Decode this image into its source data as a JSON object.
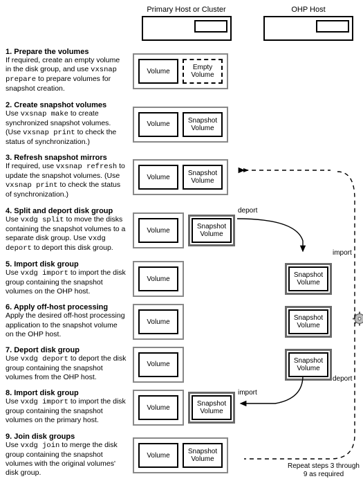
{
  "headers": {
    "primary": "Primary Host or Cluster",
    "ohp": "OHP Host"
  },
  "labels": {
    "volume": "Volume",
    "empty_volume": "Empty Volume",
    "snapshot_volume": "Snapshot Volume",
    "deport": "deport",
    "import": "import",
    "repeat": "Repeat steps 3 through 9 as required"
  },
  "steps": [
    {
      "title": "1. Prepare the volumes",
      "body_parts": [
        "If required, create an empty volume in the disk group, and use ",
        "vxsnap prepare",
        " to prepare volumes for snapshot creation."
      ]
    },
    {
      "title": "2. Create snapshot volumes",
      "body_parts": [
        "Use ",
        "vxsnap make",
        " to create synchronized snapshot volumes. (Use ",
        "vxsnap print",
        " to check the status of synchronization.)"
      ]
    },
    {
      "title": "3. Refresh snapshot mirrors",
      "body_parts": [
        "If required, use ",
        "vxsnap refresh",
        " to update the snapshot volumes. (Use ",
        "vxsnap print",
        " to check the status of synchronization.)"
      ]
    },
    {
      "title": "4. Split and deport disk group",
      "body_parts": [
        "Use ",
        "vxdg split",
        " to move the disks containing the snapshot volumes to a separate disk group. Use ",
        "vxdg deport",
        " to deport this disk group."
      ]
    },
    {
      "title": "5. Import disk group",
      "body_parts": [
        "Use ",
        "vxdg import",
        " to import the disk group containing the snapshot volumes on the OHP host."
      ]
    },
    {
      "title": "6. Apply off-host processing",
      "body_parts": [
        "Apply the desired off-host processing application to the snapshot volume on the OHP host."
      ]
    },
    {
      "title": "7. Deport disk group",
      "body_parts": [
        "Use ",
        "vxdg deport",
        " to deport the disk group containing the snapshot volumes from the OHP host."
      ]
    },
    {
      "title": "8. Import disk group",
      "body_parts": [
        "Use ",
        "vxdg import",
        " to import the disk group containing the snapshot volumes on the primary host."
      ]
    },
    {
      "title": "9. Join disk groups",
      "body_parts": [
        "Use ",
        "vxdg join",
        " to merge the disk group containing the snapshot volumes with the original volumes' disk group."
      ]
    }
  ]
}
